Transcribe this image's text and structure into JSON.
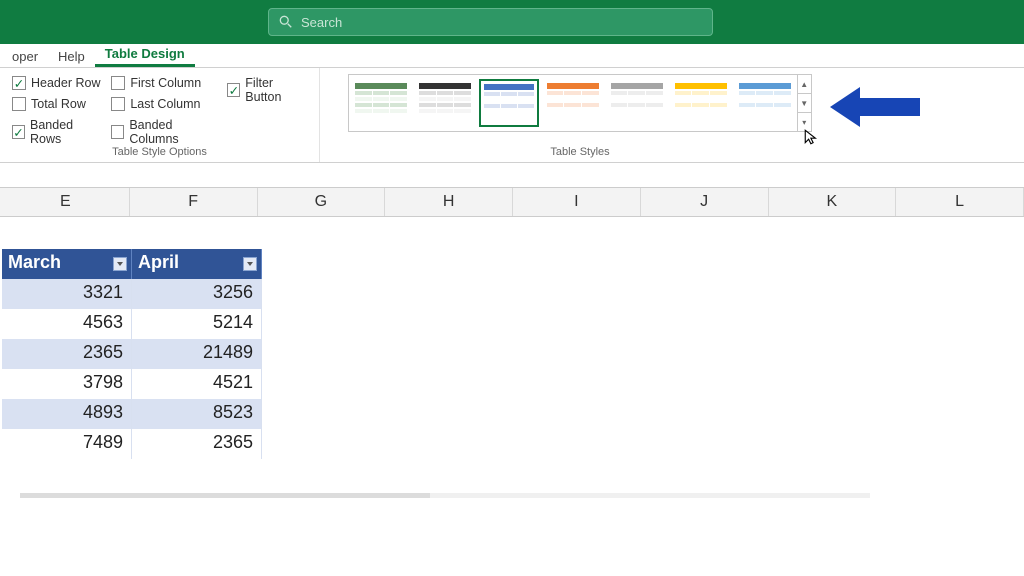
{
  "search": {
    "placeholder": "Search"
  },
  "tabs": {
    "t0": "oper",
    "t1": "Help",
    "t2": "Table Design"
  },
  "options": {
    "header_row": "Header Row",
    "total_row": "Total Row",
    "banded_rows": "Banded Rows",
    "first_column": "First Column",
    "last_column": "Last Column",
    "banded_columns": "Banded Columns",
    "filter_button": "Filter Button",
    "group_label": "Table Style Options"
  },
  "styles": {
    "group_label": "Table Styles"
  },
  "columns": {
    "E": "E",
    "F": "F",
    "G": "G",
    "H": "H",
    "I": "I",
    "J": "J",
    "K": "K",
    "L": "L"
  },
  "table": {
    "headers": {
      "h0": "March",
      "h1": "April"
    },
    "rows": [
      {
        "c0": "3321",
        "c1": "3256"
      },
      {
        "c0": "4563",
        "c1": "5214"
      },
      {
        "c0": "2365",
        "c1": "21489"
      },
      {
        "c0": "3798",
        "c1": "4521"
      },
      {
        "c0": "4893",
        "c1": "8523"
      },
      {
        "c0": "7489",
        "c1": "2365"
      }
    ]
  }
}
